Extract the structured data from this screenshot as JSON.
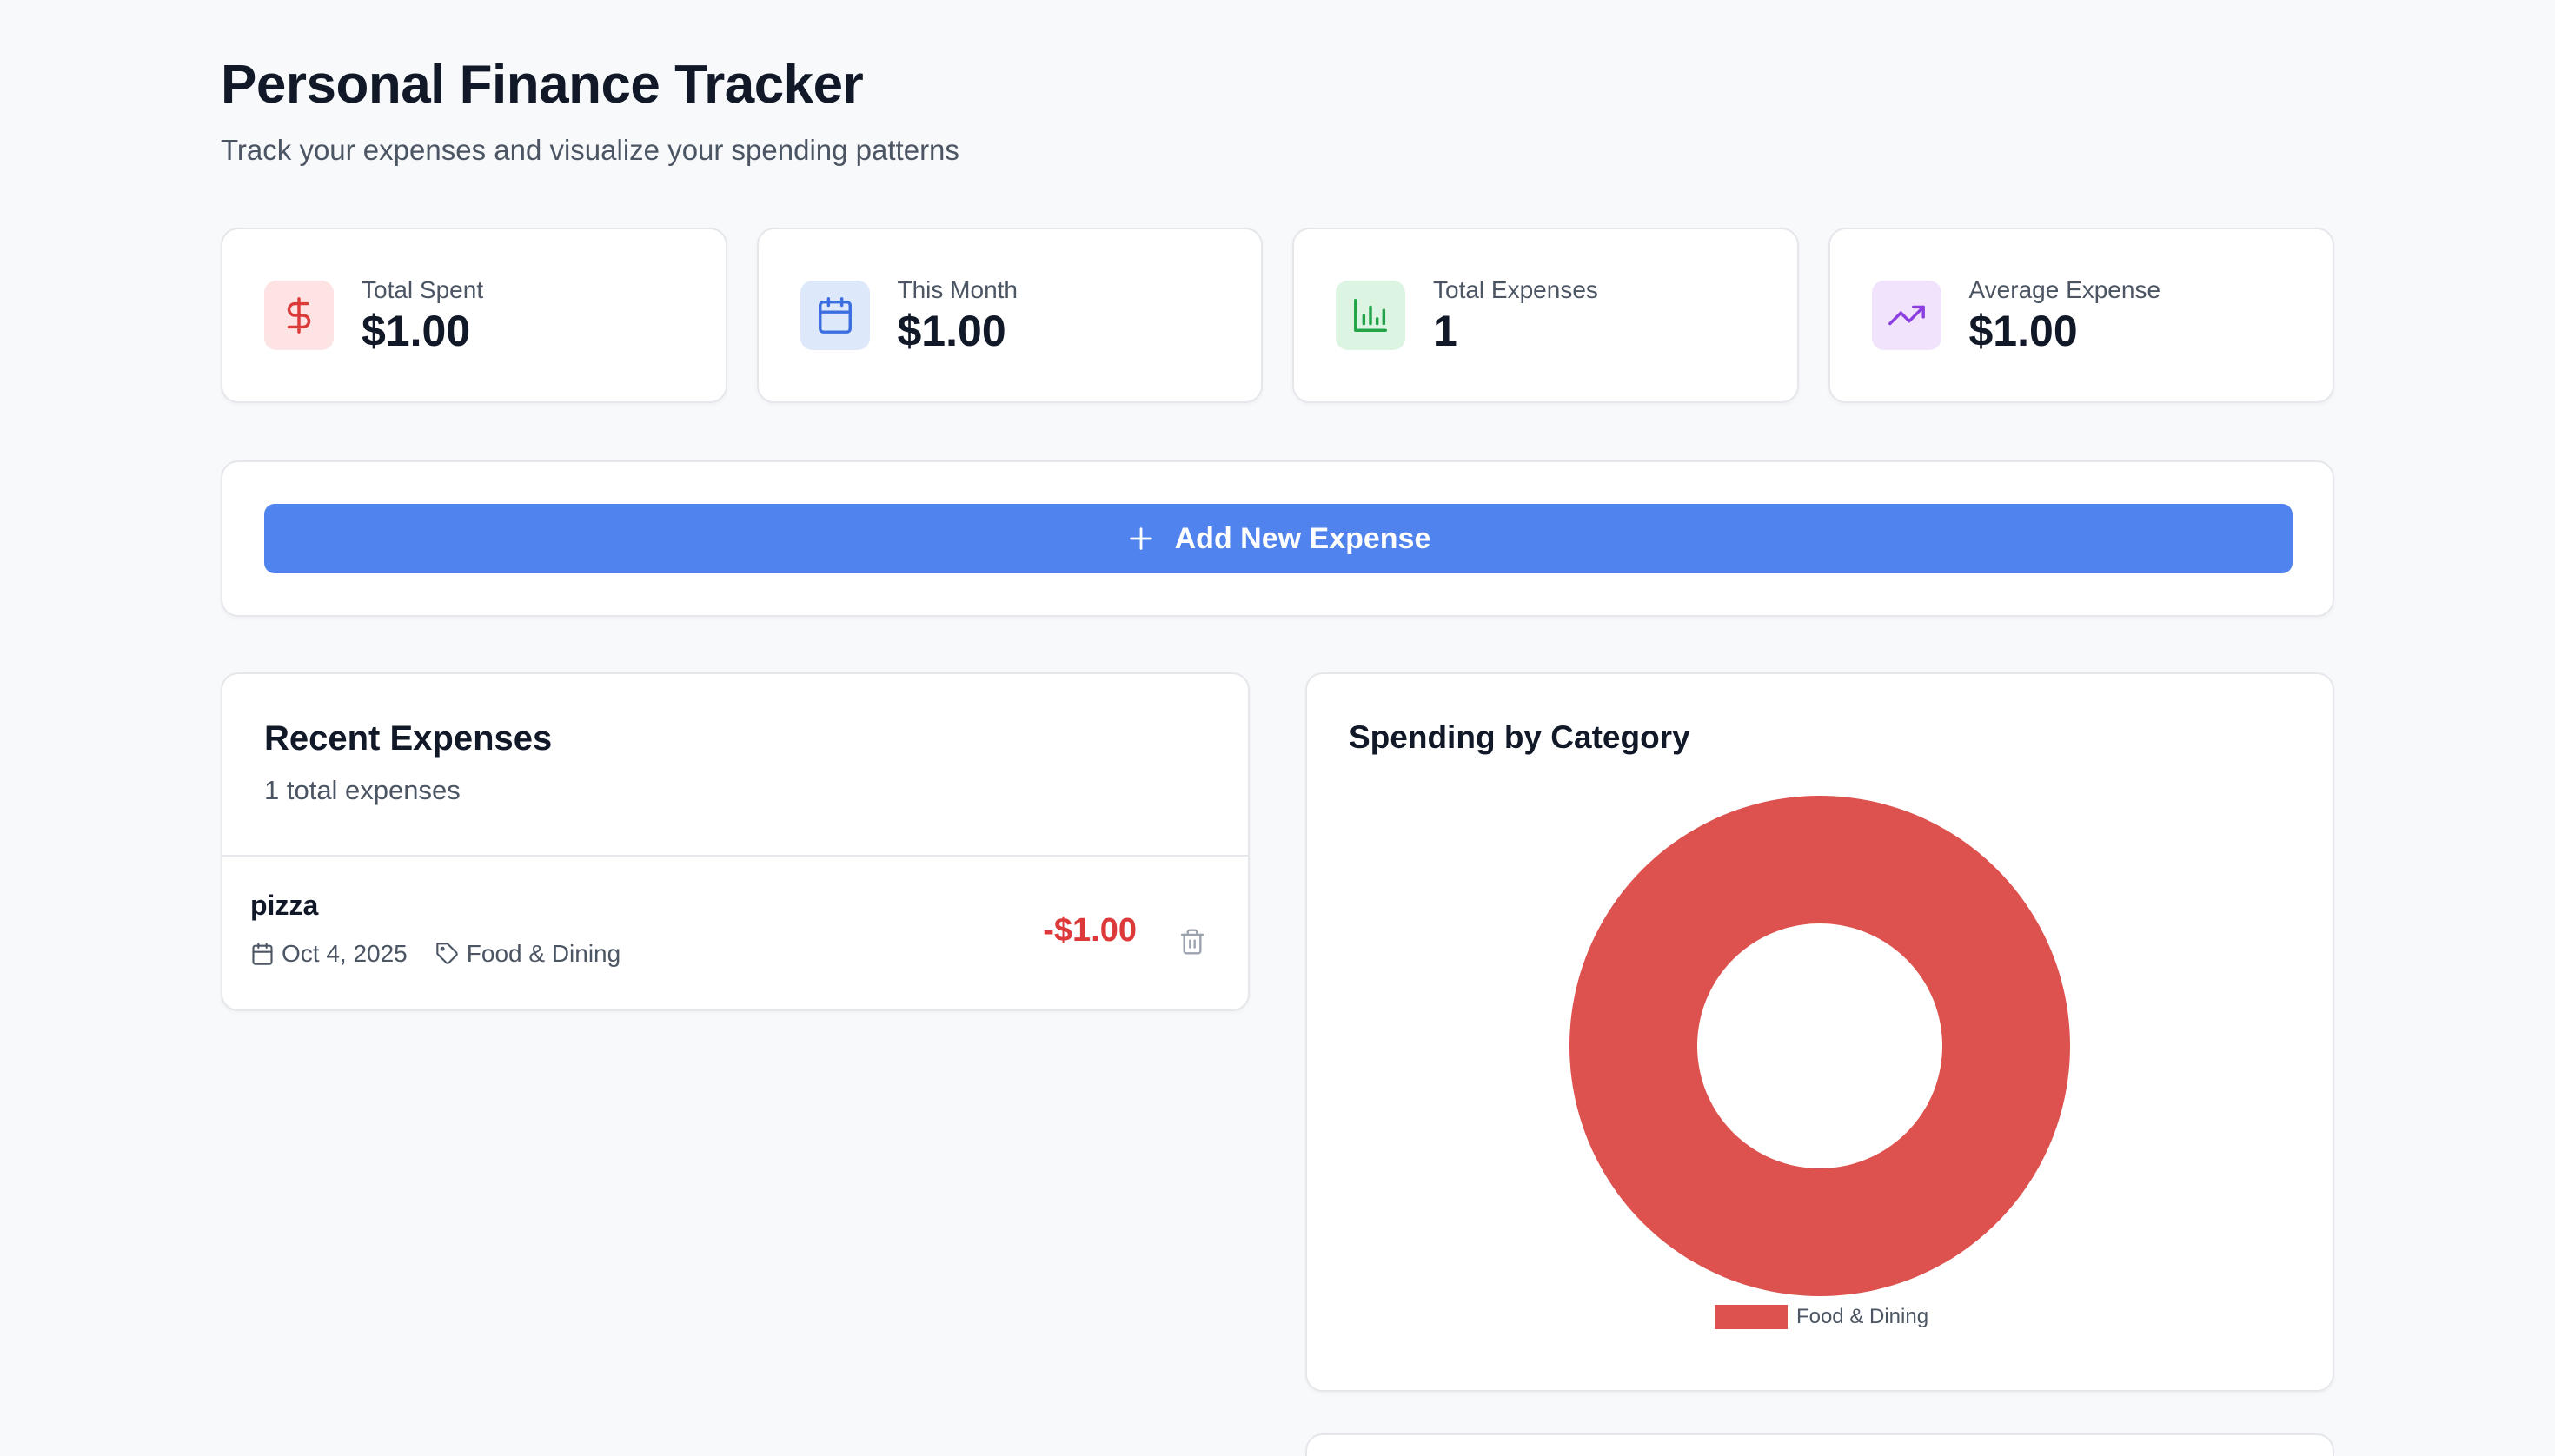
{
  "header": {
    "title": "Personal Finance Tracker",
    "subtitle": "Track your expenses and visualize your spending patterns"
  },
  "stats": [
    {
      "label": "Total Spent",
      "value": "$1.00",
      "icon": "dollar-icon",
      "color": "#dc3a3a",
      "bg": "#fde3e3"
    },
    {
      "label": "This Month",
      "value": "$1.00",
      "icon": "calendar-icon",
      "color": "#3b6fe0",
      "bg": "#dde8fb"
    },
    {
      "label": "Total Expenses",
      "value": "1",
      "icon": "bar-chart-icon",
      "color": "#22a447",
      "bg": "#dcf5e3"
    },
    {
      "label": "Average Expense",
      "value": "$1.00",
      "icon": "trending-up-icon",
      "color": "#8b3fe0",
      "bg": "#f0e3fb"
    }
  ],
  "actions": {
    "add_label": "Add New Expense",
    "add_color": "#5083ee"
  },
  "expenses": {
    "title": "Recent Expenses",
    "count_text": "1 total expenses",
    "items": [
      {
        "name": "pizza",
        "date": "Oct 4, 2025",
        "category": "Food & Dining",
        "amount": "-$1.00"
      }
    ]
  },
  "chart_data": {
    "type": "pie",
    "title": "Spending by Category",
    "donut": true,
    "categories": [
      "Food & Dining"
    ],
    "values": [
      1.0
    ],
    "colors": [
      "#dd524e"
    ],
    "legend": "bottom"
  }
}
